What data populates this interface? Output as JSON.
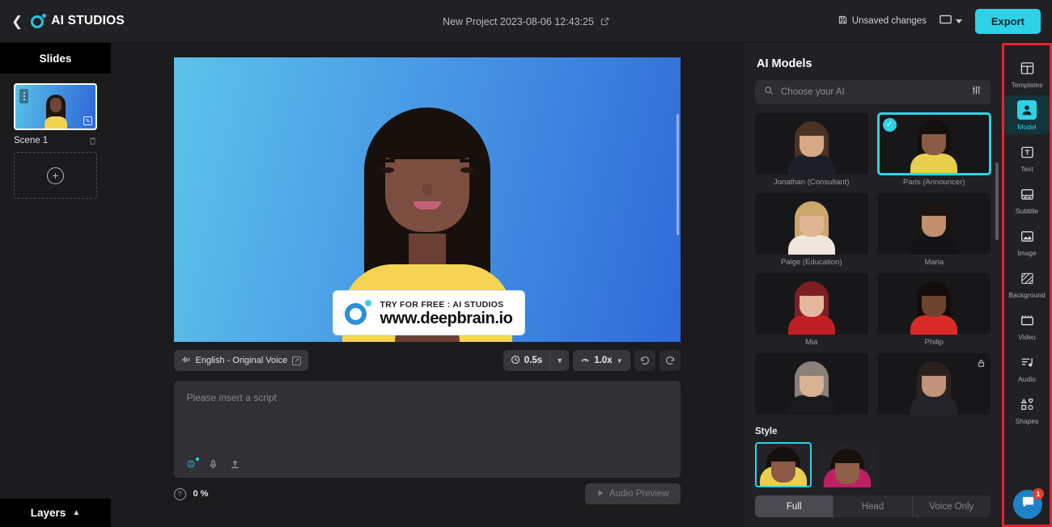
{
  "header": {
    "back_icon": "chevron-left-icon",
    "brand": "AI STUDIOS",
    "project_title": "New Project 2023-08-06 12:43:25",
    "edit_icon": "external-link-icon",
    "unsaved_label": "Unsaved changes",
    "save_icon": "floppy-disk-icon",
    "ratio_icon": "aspect-ratio-icon",
    "export_label": "Export",
    "accent_color": "#2ed2e6"
  },
  "slides": {
    "title": "Slides",
    "scene_label": "Scene 1",
    "menu_icon": "kebab-menu-icon",
    "edit_icon": "edit-square-icon",
    "delete_icon": "trash-icon",
    "add_icon": "plus-circle-icon",
    "layers_label": "Layers",
    "layers_caret": "chevron-up-icon"
  },
  "stage": {
    "watermark_top": "TRY FOR FREE : AI STUDIOS",
    "watermark_bottom": "www.deepbrain.io"
  },
  "toolbar": {
    "voice_label": "English - Original Voice",
    "voice_icon": "voice-wave-icon",
    "voice_ext_icon": "external-link-icon",
    "pause_icon": "clock-icon",
    "pause_value": "0.5s",
    "pause_caret": "chevron-down-icon",
    "speed_icon": "speed-gauge-icon",
    "speed_value": "1.0x",
    "speed_caret": "chevron-down-icon",
    "undo_icon": "undo-icon",
    "redo_icon": "redo-icon"
  },
  "script": {
    "placeholder": "Please insert a script",
    "value": "",
    "ai_icon": "ai-assist-icon",
    "mic_icon": "microphone-icon",
    "upload_icon": "upload-icon",
    "help_icon": "question-mark-icon",
    "percent": "0 %",
    "audio_preview_label": "Audio Preview",
    "audio_preview_icon": "play-icon"
  },
  "models_panel": {
    "title": "AI Models",
    "search_placeholder": "Choose your AI",
    "search_icon": "search-icon",
    "filter_icon": "sliders-filter-icon",
    "check_icon": "check-icon",
    "lock_icon": "lock-icon",
    "models": [
      {
        "name": "Jonathan (Consultant)",
        "selected": false,
        "locked": false,
        "hair": "#4a3224",
        "face": "#d7a884",
        "torso": "#1d1f28",
        "neck": "#c79a78"
      },
      {
        "name": "Paris (Announcer)",
        "selected": true,
        "locked": false,
        "hair": "#14100e",
        "face": "#8a5a45",
        "torso": "#e8cf4e",
        "neck": "#7d5140"
      },
      {
        "name": "Paige (Education)",
        "selected": false,
        "locked": false,
        "hair": "#caa66a",
        "face": "#e0b595",
        "torso": "#efe6dd",
        "neck": "#d0a384"
      },
      {
        "name": "Maria",
        "selected": false,
        "locked": false,
        "hair": "#1b1410",
        "face": "#c08f6d",
        "torso": "#141418",
        "neck": "#b07f5f"
      },
      {
        "name": "Mia",
        "selected": false,
        "locked": false,
        "hair": "#7d1f22",
        "face": "#e3b89c",
        "torso": "#c01f26",
        "neck": "#d5a78c"
      },
      {
        "name": "Philip",
        "selected": false,
        "locked": false,
        "hair": "#120d0a",
        "face": "#6b4430",
        "torso": "#d92a26",
        "neck": "#5d3a29"
      },
      {
        "name": "",
        "selected": false,
        "locked": false,
        "hair": "#888079",
        "face": "#d9b193",
        "torso": "#1a1a1e",
        "neck": "#c49a7c"
      },
      {
        "name": "",
        "selected": false,
        "locked": true,
        "hair": "#2a211c",
        "face": "#c3927a",
        "torso": "#23232a",
        "neck": "#b3836a"
      }
    ],
    "style": {
      "title": "Style",
      "items": [
        {
          "selected": true,
          "hair": "#14100e",
          "face": "#8a5a45",
          "torso": "#e8cf4e"
        },
        {
          "selected": false,
          "hair": "#17110d",
          "face": "#8f5f48",
          "torso": "#bf2064"
        }
      ]
    },
    "segments": [
      {
        "label": "Full",
        "active": true
      },
      {
        "label": "Head",
        "active": false
      },
      {
        "label": "Voice Only",
        "active": false
      }
    ]
  },
  "rail": {
    "items": [
      {
        "label": "Templates",
        "icon": "templates-icon",
        "active": false
      },
      {
        "label": "Model",
        "icon": "model-person-icon",
        "active": true
      },
      {
        "label": "Text",
        "icon": "text-t-icon",
        "active": false
      },
      {
        "label": "Subtitle",
        "icon": "subtitle-icon",
        "active": false
      },
      {
        "label": "Image",
        "icon": "image-icon",
        "active": false
      },
      {
        "label": "Background",
        "icon": "background-pattern-icon",
        "active": false
      },
      {
        "label": "Video",
        "icon": "video-clapper-icon",
        "active": false
      },
      {
        "label": "Audio",
        "icon": "audio-note-icon",
        "active": false
      },
      {
        "label": "Shapes",
        "icon": "shapes-icon",
        "active": false
      }
    ],
    "highlight_color": "#e8222a"
  },
  "chat": {
    "icon": "chat-bubble-icon",
    "badge": "1"
  }
}
